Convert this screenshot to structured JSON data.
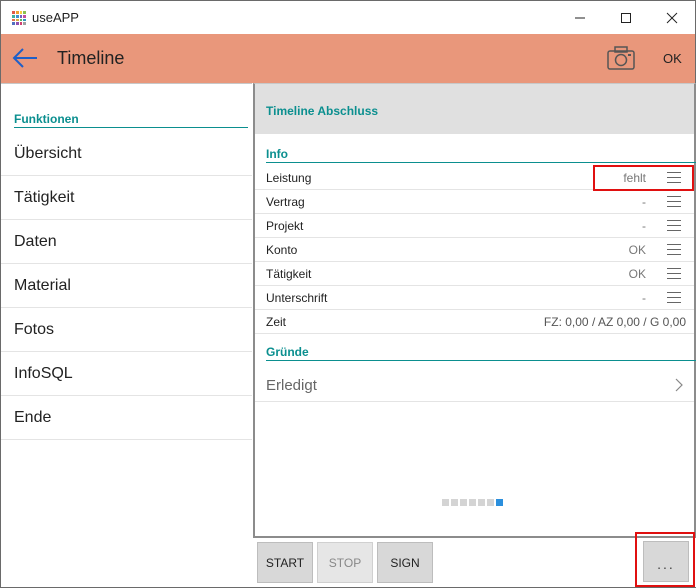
{
  "window": {
    "title": "useAPP"
  },
  "header": {
    "title": "Timeline",
    "ok_label": "OK"
  },
  "sidebar": {
    "heading": "Funktionen",
    "items": [
      {
        "label": "Übersicht"
      },
      {
        "label": "Tätigkeit"
      },
      {
        "label": "Daten"
      },
      {
        "label": "Material"
      },
      {
        "label": "Fotos"
      },
      {
        "label": "InfoSQL"
      },
      {
        "label": "Ende"
      }
    ]
  },
  "main": {
    "title": "Timeline Abschluss",
    "info_heading": "Info",
    "rows": [
      {
        "label": "Leistung",
        "value": "fehlt"
      },
      {
        "label": "Vertrag",
        "value": "-"
      },
      {
        "label": "Projekt",
        "value": "-"
      },
      {
        "label": "Konto",
        "value": "OK"
      },
      {
        "label": "Tätigkeit",
        "value": "OK"
      },
      {
        "label": "Unterschrift",
        "value": "-"
      },
      {
        "label": "Zeit",
        "value": "FZ: 0,00 / AZ 0,00 / G 0,00"
      }
    ],
    "gruende_heading": "Gründe",
    "gruende_item": "Erledigt",
    "pager": {
      "pages": 7,
      "active": 7
    }
  },
  "toolbar": {
    "start_label": "START",
    "stop_label": "STOP",
    "sign_label": "SIGN",
    "more_label": "..."
  },
  "colors": {
    "accent": "#0b8f8f",
    "header": "#e9977b",
    "highlight": "#e01010",
    "pager_active": "#2b8fdd"
  }
}
